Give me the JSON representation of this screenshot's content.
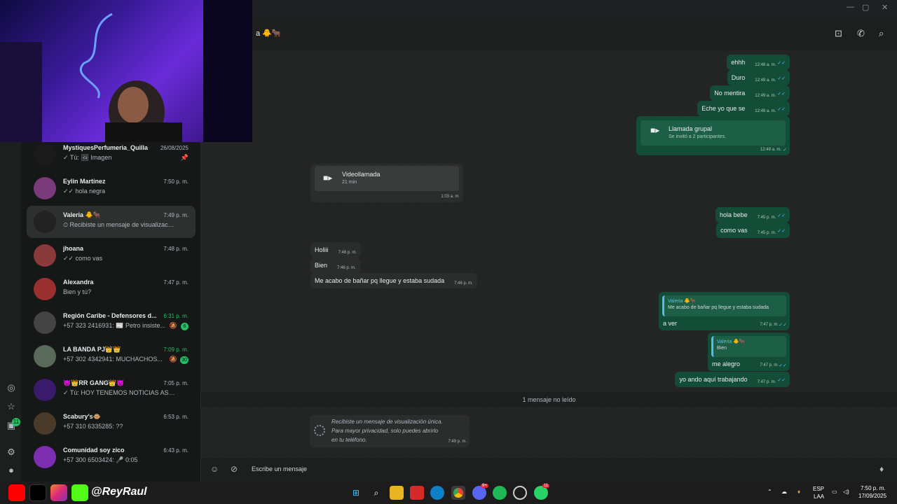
{
  "window": {
    "controls": [
      "—",
      "▢",
      "✕"
    ]
  },
  "header": {
    "title": "a 🐥🐂"
  },
  "chats": [
    {
      "name": "MystiquesPerfumeria_Quilla",
      "preview": "✓ Tú: 🖼 Imagen",
      "time": "26/08/2025",
      "pinned": true,
      "color": "#1a1a1a"
    },
    {
      "name": "Eylin Martinez",
      "preview": "✓✓ hola negra",
      "time": "7:50 p. m.",
      "color": "#7a3b7a"
    },
    {
      "name": "Valeria 🐥🐂",
      "preview": "⏲ Recibiste un mensaje de visualizació...",
      "time": "7:49 p. m.",
      "selected": true,
      "color": "#222"
    },
    {
      "name": "jhoana",
      "preview": "✓✓ como vas",
      "time": "7:48 p. m.",
      "color": "#8a3a3a"
    },
    {
      "name": "Alexandra",
      "preview": "Bien y tú?",
      "time": "7:47 p. m.",
      "color": "#9a3030"
    },
    {
      "name": "Región Caribe - Defensores d...",
      "preview": "+57 323 2416931: 📰 Petro insiste...",
      "time": "6:31 p. m.",
      "badge": "6",
      "muted": true,
      "green": true,
      "color": "#444"
    },
    {
      "name": "LA BANDA PJ👑👑",
      "preview": "+57 302 4342941: MUCHACHOS...",
      "time": "7:09 p. m.",
      "badge": "30",
      "muted": true,
      "green": true,
      "color": "#5a6a5a"
    },
    {
      "name": "😈👑RR GANG👑😈",
      "preview": "✓ Tú: HOY TENEMOS NOTICIAS ASI QU...",
      "time": "7:05 p. m.",
      "color": "#3a1a6a"
    },
    {
      "name": "Scabury's🐵",
      "preview": "+57 310 6335285: ??",
      "time": "6:53 p. m.",
      "color": "#4a3a2a"
    },
    {
      "name": "Comunidad soy zico",
      "preview": "+57 300 6503424: 🎤 0:05",
      "time": "6:43 p. m.",
      "color": "#7b2fb0"
    }
  ],
  "messages_out_top": [
    {
      "text": "ehhh",
      "time": "12:48 a. m."
    },
    {
      "text": "Duro",
      "time": "12:49 a. m."
    },
    {
      "text": "No mentira",
      "time": "12:49 a. m."
    },
    {
      "text": "Eche yo que se",
      "time": "12:49 a. m."
    }
  ],
  "group_call": {
    "title": "Llamada grupal",
    "subtitle": "Se invitó a 2 participantes.",
    "time": "12:49 a. m."
  },
  "video_call": {
    "title": "Videollamada",
    "subtitle": "21 min",
    "time": "1:03 a. m."
  },
  "messages_out_mid": [
    {
      "text": "hola bebe",
      "time": "7:45 p. m."
    },
    {
      "text": "como vas",
      "time": "7:45 p. m."
    }
  ],
  "messages_in": [
    {
      "text": "Holiii",
      "time": "7:46 p. m."
    },
    {
      "text": "Bien",
      "time": "7:46 p. m."
    },
    {
      "text": "Me acabo de bañar pq llegue y estaba sudada",
      "time": "7:46 p. m."
    }
  ],
  "reply1": {
    "quote_name": "Valeria 🐥🐂",
    "quote_text": "Me acabo de bañar pq llegue y estaba sudada",
    "text": "a ver",
    "time": "7:47 p. m."
  },
  "reply2": {
    "quote_name": "Valeria 🐥🐂",
    "quote_text": "Bien",
    "text": "me alegro",
    "time": "7:47 p. m."
  },
  "last_out": {
    "text": "yo ando aquí trabajando",
    "time": "7:47 p. m."
  },
  "unread_label": "1 mensaje no leído",
  "view_once": {
    "line1": "Recibiste un mensaje de visualización única.",
    "line2": "Para mayor privacidad, solo puedes abrirlo",
    "line3": "en tu teléfono.",
    "time": "7:49 p. m."
  },
  "composer": {
    "placeholder": "Escribe un mensaje"
  },
  "rail": {
    "badge": "11"
  },
  "overlay": {
    "handle": "@ReyRaul"
  },
  "taskbar": {
    "lang1": "ESP",
    "lang2": "LAA",
    "time": "7:50 p. m.",
    "date": "17/09/2025",
    "discord_badge": "9+",
    "whatsapp_badge": "11"
  },
  "colors": {
    "outgoing": "#144d37",
    "incoming": "#2b2c2c",
    "accent": "#21c063"
  }
}
